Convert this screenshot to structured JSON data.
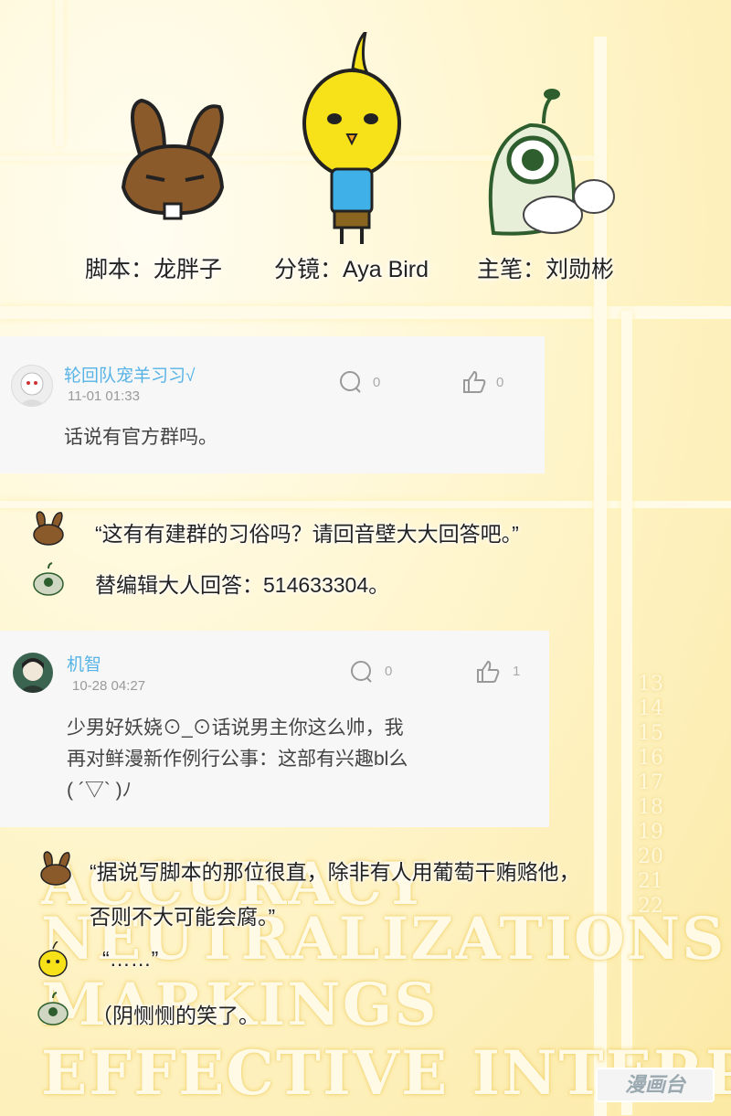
{
  "credits": {
    "script": "脚本：龙胖子",
    "storyboard": "分镜：Aya Bird",
    "artist": "主笔：刘勋彬"
  },
  "comments": [
    {
      "user": "轮回队宠羊习习√",
      "time": "11-01 01:33",
      "body": "话说有官方群吗。",
      "replies": "0",
      "likes": "0"
    },
    {
      "user": "机智",
      "time": "10-28 04:27",
      "body_line1": "少男好妖娆⊙_⊙话说男主你这么帅，我",
      "body_line2": "再对鲜漫新作例行公事：这部有兴趣bl么",
      "body_line3": "( ´▽` )ﾉ",
      "replies": "0",
      "likes": "1"
    }
  ],
  "replies_block1": [
    {
      "speaker": "rabbit",
      "text": "“这有有建群的习俗吗？请回音壁大大回答吧。”"
    },
    {
      "speaker": "sprout",
      "text": "替编辑大人回答：514633304。"
    }
  ],
  "replies_block2": [
    {
      "speaker": "rabbit",
      "text_line1": "“据说写脚本的那位很直，除非有人用葡萄干贿赂他，",
      "text_line2": "否则不大可能会腐。”"
    },
    {
      "speaker": "chick",
      "text": "“……”"
    },
    {
      "speaker": "sprout",
      "text": "（阴恻恻的笑了。"
    }
  ],
  "background_text": [
    "ACCURACY",
    "NEUTRALIZATIONS",
    "MARKINGS",
    "EFFECTIVE INTERP"
  ],
  "background_numbers": [
    "13",
    "14",
    "15",
    "16",
    "17",
    "18",
    "19",
    "20",
    "21",
    "22"
  ],
  "watermark": "漫画台",
  "colors": {
    "username": "#57b3e6",
    "rabbit": "#8a5a2b",
    "chick": "#f7e21a",
    "shirt": "#3fb0e8"
  }
}
